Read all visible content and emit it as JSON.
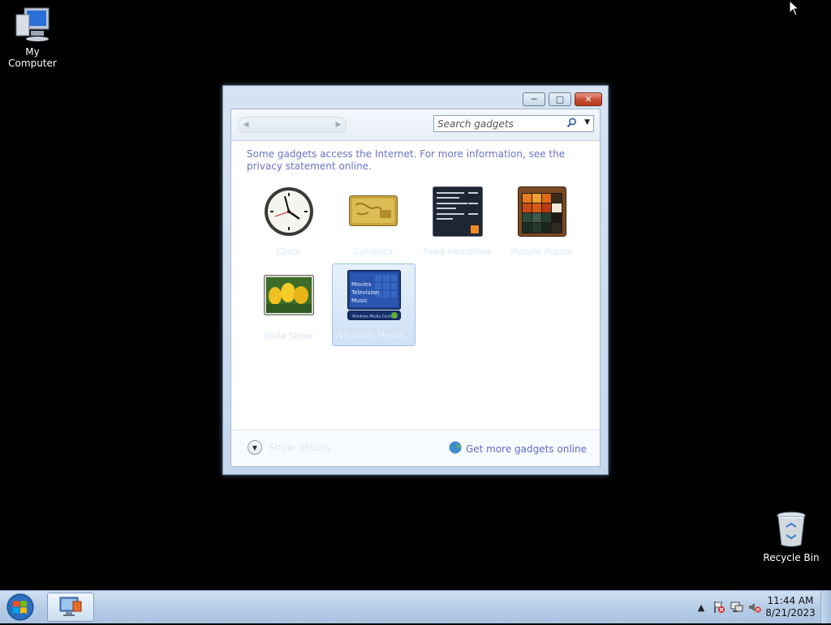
{
  "desktop": {
    "icons": [
      {
        "label": "My Computer",
        "icon": "computer-icon"
      },
      {
        "label": "Recycle Bin",
        "icon": "recycle-bin-icon"
      }
    ]
  },
  "gadget_window": {
    "caption_buttons": {
      "minimize": "minimize",
      "restore": "restore",
      "close": "close"
    },
    "search": {
      "placeholder": "Search gadgets",
      "value": ""
    },
    "notice": "Some gadgets access the Internet.  For more information, see the privacy statement online.",
    "gadgets": [
      {
        "name": "Clock",
        "icon": "clock-icon",
        "selected": false
      },
      {
        "name": "Currency",
        "icon": "currency-icon",
        "selected": false
      },
      {
        "name": "Feed Headlines",
        "icon": "feed-headlines-icon",
        "selected": false
      },
      {
        "name": "Picture Puzzle",
        "icon": "picture-puzzle-icon",
        "selected": false
      },
      {
        "name": "Slide Show",
        "icon": "slide-show-icon",
        "selected": false
      },
      {
        "name": "Windows Media...",
        "icon": "windows-media-center-icon",
        "selected": true
      }
    ],
    "media_center_thumb": {
      "lines": [
        "Movies",
        "Television",
        "Music"
      ],
      "footer": "Windows Media Center"
    },
    "show_details": "Show details",
    "get_more": "Get more gadgets online"
  },
  "taskbar": {
    "start": "start-orb-icon",
    "clock": {
      "time": "11:44 AM",
      "date": "8/21/2023"
    },
    "tray_icons": [
      "show-hidden-icons",
      "action-center-icon",
      "network-icon",
      "volume-muted-icon"
    ]
  },
  "colors": {
    "accent_link": "#5b6bcf",
    "notice_text": "#6a73c9",
    "taskbar": "#b6cde6"
  }
}
